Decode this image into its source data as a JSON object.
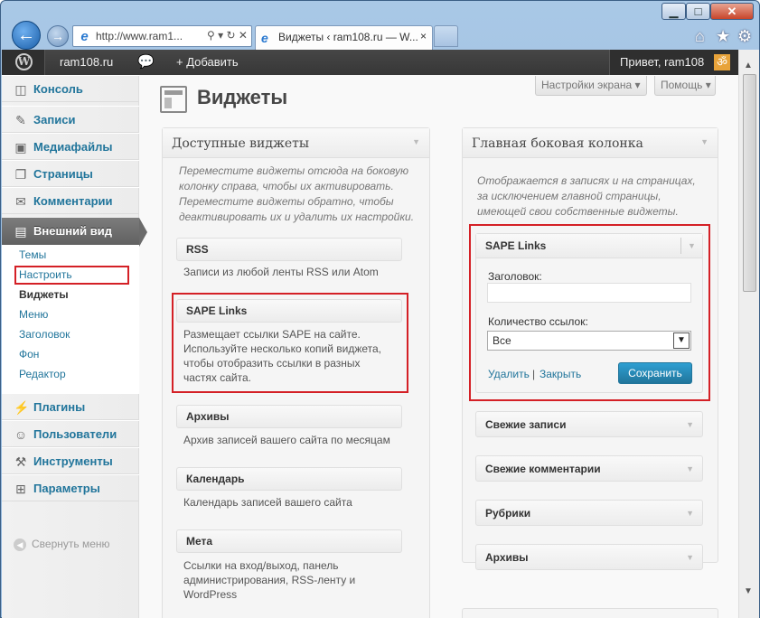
{
  "browser": {
    "address": "http://www.ram1...",
    "tab_title": "Виджеты ‹ ram108.ru — W...",
    "tab_close": "×",
    "win_min": "▁",
    "win_max": "□",
    "win_close": "✕"
  },
  "admin_bar": {
    "wp_logo": "W",
    "site": "ram108.ru",
    "add_new": "+ Добавить",
    "greeting": "Привет, ram108",
    "avatar_glyph": "ॐ"
  },
  "sidebar": {
    "items": [
      {
        "label": "Консоль",
        "icon": "dashboard-icon"
      },
      {
        "label": "Записи",
        "icon": "posts-icon"
      },
      {
        "label": "Медиафайлы",
        "icon": "media-icon"
      },
      {
        "label": "Страницы",
        "icon": "pages-icon"
      },
      {
        "label": "Комментарии",
        "icon": "comments-icon"
      },
      {
        "label": "Внешний вид",
        "icon": "appearance-icon"
      },
      {
        "label": "Плагины",
        "icon": "plugins-icon"
      },
      {
        "label": "Пользователи",
        "icon": "users-icon"
      },
      {
        "label": "Инструменты",
        "icon": "tools-icon"
      },
      {
        "label": "Параметры",
        "icon": "settings-icon"
      }
    ],
    "submenu": [
      "Темы",
      "Настроить",
      "Виджеты",
      "Меню",
      "Заголовок",
      "Фон",
      "Редактор"
    ],
    "collapse": "Свернуть меню"
  },
  "page": {
    "title": "Виджеты",
    "screen_options": "Настройки экрана",
    "help": "Помощь"
  },
  "available": {
    "title": "Доступные виджеты",
    "desc": "Переместите виджеты отсюда на боковую колонку справа, чтобы их активировать. Переместите виджеты обратно, чтобы деактивировать их и удалить их настройки.",
    "widgets": [
      {
        "name": "RSS",
        "desc": "Записи из любой ленты RSS или Atom"
      },
      {
        "name": "SAPE Links",
        "desc": "Размещает ссылки SAPE на сайте. Используйте несколько копий виджета, чтобы отобразить ссылки в разных частях сайта."
      },
      {
        "name": "Архивы",
        "desc": "Архив записей вашего сайта по месяцам"
      },
      {
        "name": "Календарь",
        "desc": "Календарь записей вашего сайта"
      },
      {
        "name": "Мета",
        "desc": "Ссылки на вход/выход, панель администрирования, RSS-ленту и WordPress"
      }
    ]
  },
  "sidebar_area": {
    "title": "Главная боковая колонка",
    "desc": "Отображается в записях и на страницах, за исключением главной страницы, имеющей свои собственные виджеты.",
    "open_widget": {
      "name": "SAPE Links",
      "title_label": "Заголовок:",
      "title_value": "",
      "count_label": "Количество ссылок:",
      "count_value": "Все",
      "delete": "Удалить",
      "separator": "|",
      "close": "Закрыть",
      "save": "Сохранить"
    },
    "widgets": [
      "Свежие записи",
      "Свежие комментарии",
      "Рубрики",
      "Архивы"
    ]
  },
  "colors": {
    "link": "#21759b",
    "highlight": "#d42026",
    "primary_button": "#21759b"
  }
}
